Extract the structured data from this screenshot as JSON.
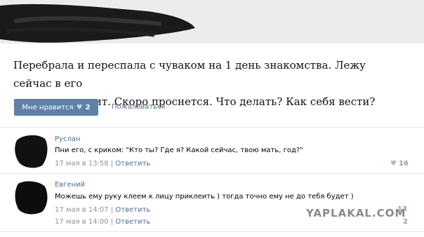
{
  "post": {
    "text_line1": "Перебрала и переспала с чуваком на 1 день знакомства. Лежу сейчас в его",
    "text_line2": "постели, он спит. Скоро проснется. Что делать? Как себя вести?",
    "like_label": "Мне нравится",
    "like_count": "2",
    "complain_label": "Пожаловаться"
  },
  "comments": [
    {
      "author": "Руслан",
      "text": "Пни его, с криком: \"Кто ты? Где я? Какой сейчас, твою мать, год?\"",
      "date": "17 мая в 13:58",
      "separator": "|",
      "reply_label": "Ответить",
      "likes": "16"
    },
    {
      "author": "Евгений",
      "text": "Можешь ему руку клеем к лицу приклеить ) тогда точно ему не до тебя будет )",
      "date": "17 мая в 14:07",
      "separator": "|",
      "reply_label": "Ответить",
      "likes": "13"
    },
    {
      "date": "17 мая в 14:00",
      "separator": "|",
      "reply_label": "Ответить",
      "likes": "2"
    }
  ],
  "watermark": "YAPLAKAL.COM",
  "colors": {
    "like_button": "#5e81a8",
    "link": "#4e6e93",
    "meta": "#8a93a0"
  }
}
